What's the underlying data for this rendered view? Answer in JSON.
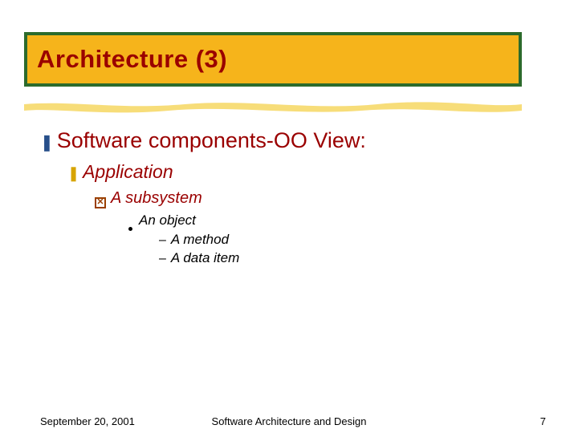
{
  "title": "Architecture (3)",
  "l1": "Software components-OO View:",
  "l2": "Application",
  "l3": "A subsystem",
  "l4": "An object",
  "l5a": "A method",
  "l5b": "A data item",
  "footer": {
    "date": "September 20, 2001",
    "center": "Software Architecture and Design",
    "page": "7"
  }
}
